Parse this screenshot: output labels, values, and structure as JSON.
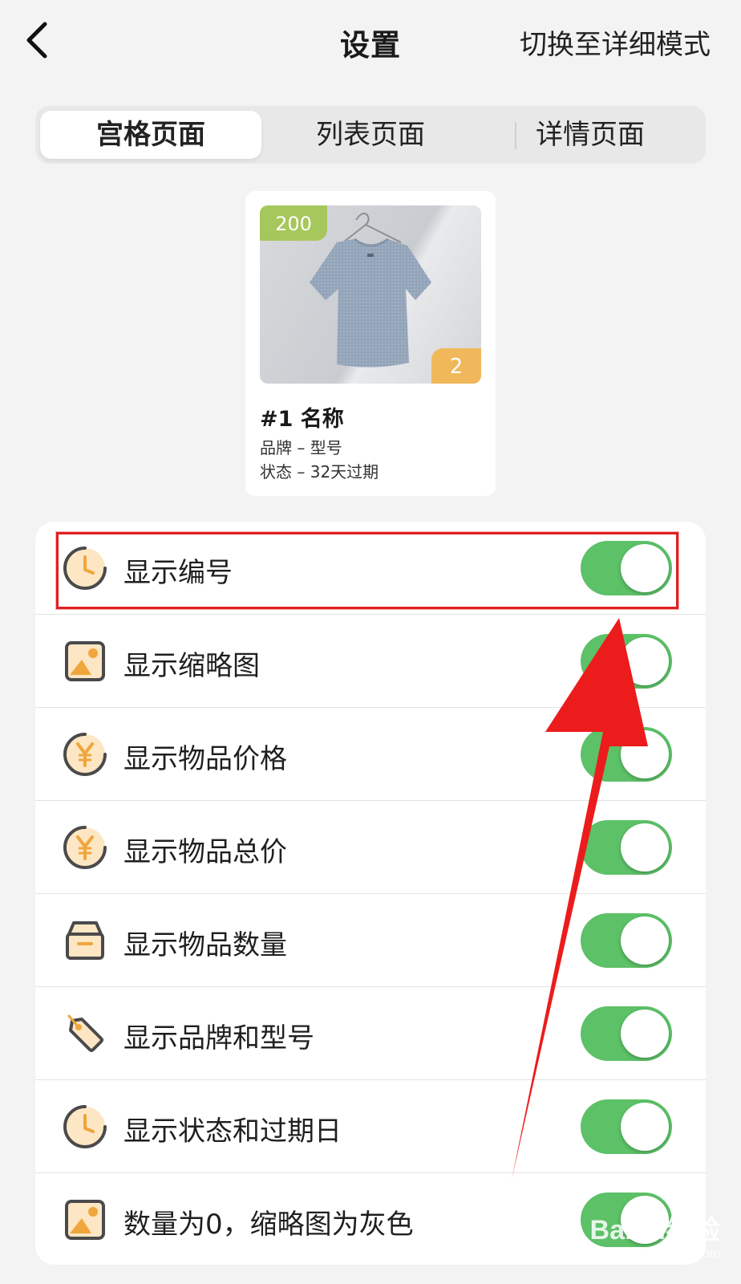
{
  "nav": {
    "title": "设置",
    "action": "切换至详细模式"
  },
  "tabs": [
    {
      "label": "宫格页面",
      "active": true
    },
    {
      "label": "列表页面",
      "active": false
    },
    {
      "label": "详情页面",
      "active": false
    }
  ],
  "preview": {
    "price": "200",
    "quantity": "2",
    "title": "#1 名称",
    "line1": "品牌 – 型号",
    "line2": "状态 – 32天过期"
  },
  "settings": [
    {
      "label": "显示编号",
      "icon": "clock-icon",
      "on": true
    },
    {
      "label": "显示缩略图",
      "icon": "image-icon",
      "on": true
    },
    {
      "label": "显示物品价格",
      "icon": "yen-icon",
      "on": true
    },
    {
      "label": "显示物品总价",
      "icon": "yen-icon",
      "on": true
    },
    {
      "label": "显示物品数量",
      "icon": "box-icon",
      "on": true
    },
    {
      "label": "显示品牌和型号",
      "icon": "tag-icon",
      "on": true
    },
    {
      "label": "显示状态和过期日",
      "icon": "clock-icon",
      "on": true
    },
    {
      "label": "数量为0，缩略图为灰色",
      "icon": "image-icon",
      "on": true
    }
  ],
  "colors": {
    "toggle_on": "#5cc167",
    "icon_fill": "#fde6c4",
    "icon_accent": "#f0a63c",
    "price_badge": "#a6c75b",
    "qty_badge": "#f0b85a",
    "annotation": "#e02020"
  },
  "watermark": {
    "main": "Baidu经验",
    "sub": "jingyan.baidu.com"
  }
}
